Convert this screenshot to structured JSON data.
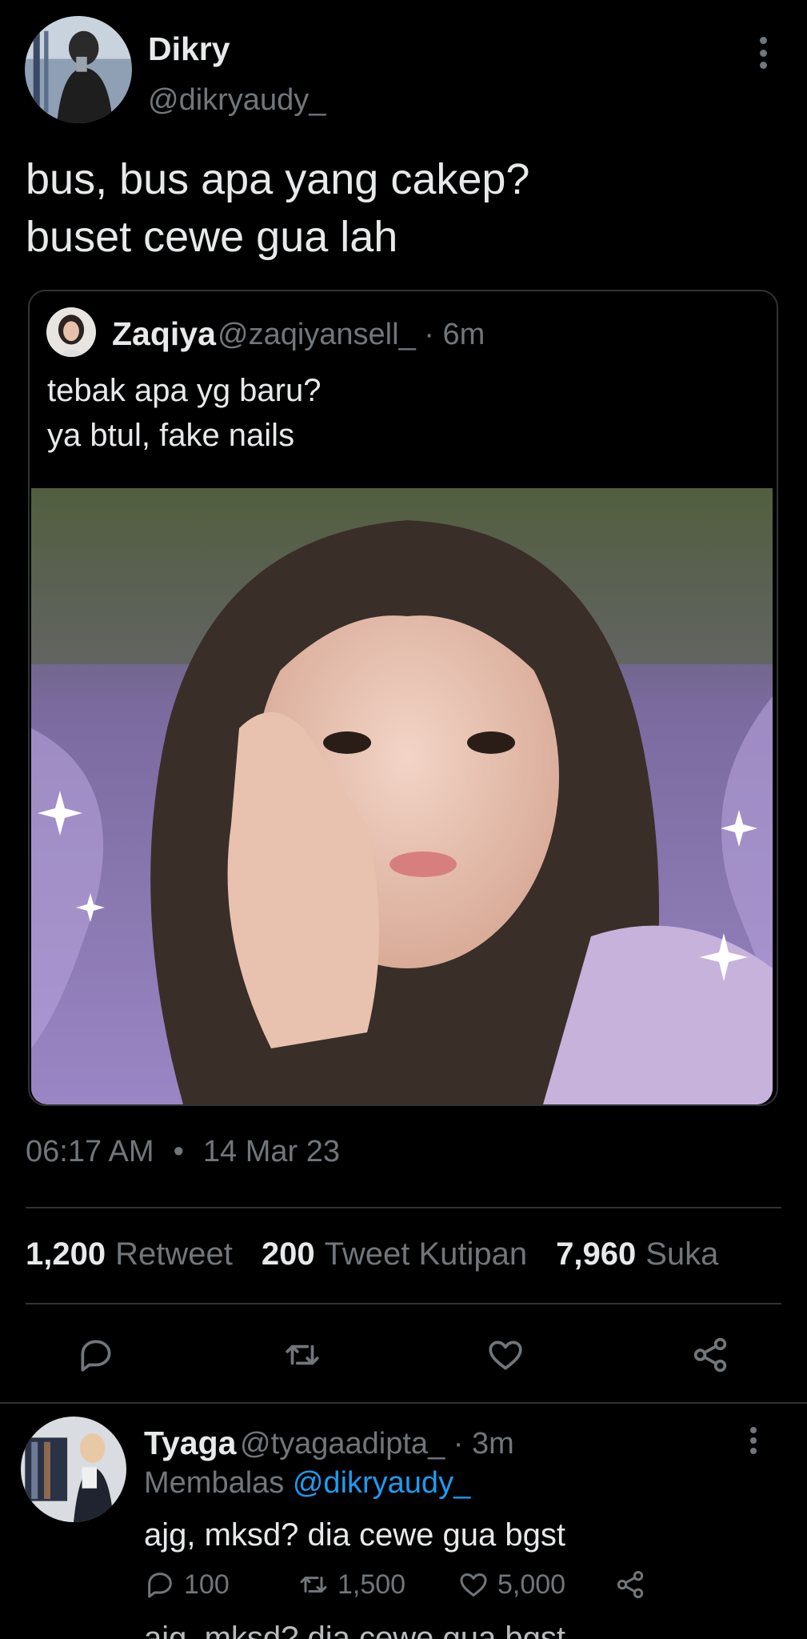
{
  "main_tweet": {
    "name": "Dikry",
    "handle": "@dikryaudy_",
    "text": "bus, bus apa yang cakep?\nbuset cewe gua lah",
    "timestamp_time": "06:17 AM",
    "timestamp_separator": "•",
    "timestamp_date": "14 Mar 23"
  },
  "quote_tweet": {
    "name": "Zaqiya",
    "handle_time": "@zaqiyansell_ · 6m",
    "text": "tebak apa yg baru?\nya btul, fake nails"
  },
  "stats": {
    "retweets_count": "1,200",
    "retweets_label": "Retweet",
    "quotes_count": "200",
    "quotes_label": "Tweet Kutipan",
    "likes_count": "7,960",
    "likes_label": "Suka"
  },
  "actions": [
    "reply-icon",
    "retweet-icon",
    "like-icon",
    "share-icon"
  ],
  "reply": {
    "name": "Tyaga",
    "handle_time": "@tyagaadipta_ · 3m",
    "replying_prefix": "Membalas",
    "replying_mention": "@dikryaudy_",
    "text": "ajg, mksd? dia cewe gua bgst",
    "reply_count": "100",
    "retweet_count": "1,500",
    "like_count": "5,000",
    "cutoff_text": "ajg, mksd? dia cewe gua bgst"
  },
  "colors": {
    "background": "#000000",
    "text_primary": "#e7e9ea",
    "text_secondary": "#71767b",
    "link": "#1d9bf0",
    "divider": "#2f3336"
  }
}
